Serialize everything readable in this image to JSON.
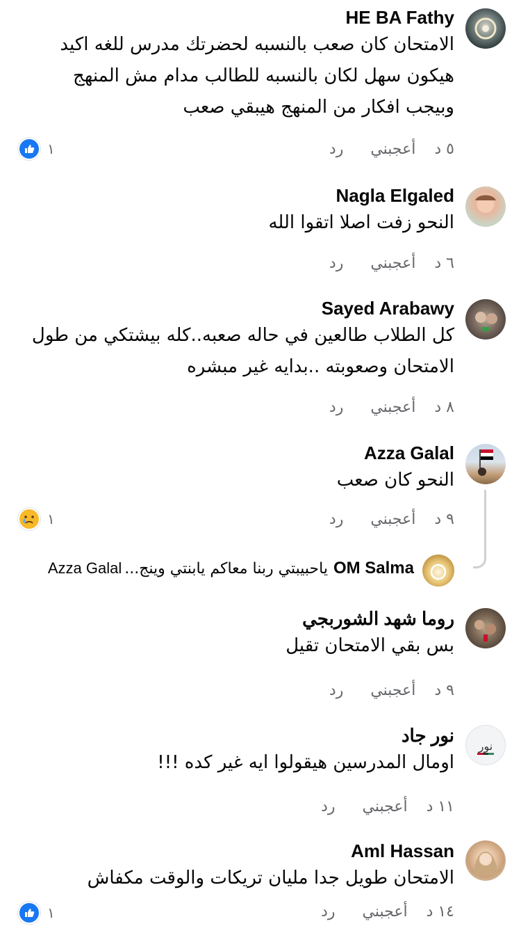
{
  "colors": {
    "meta": "#65676b",
    "like_blue": "#1877f2",
    "cry_yellow": "#f7b928",
    "thread": "#ced0d4"
  },
  "actions": {
    "like": "أعجبني",
    "reply": "رد"
  },
  "comments": [
    {
      "name": "HE BA Fathy",
      "text": "الامتحان كان صعب بالنسبه لحضرتك مدرس للغه اكيد هيكون سهل لكان بالنسبه للطالب مدام مش المنهج وبيجب افكار من المنهج هيبقي صعب",
      "time": "٥ د",
      "reaction": {
        "type": "like-icon",
        "count": "١"
      }
    },
    {
      "name": "Nagla Elgaled",
      "text": "النحو  زفت اصلا اتقوا الله",
      "time": "٦ د"
    },
    {
      "name": "Sayed Arabawy",
      "text": "كل الطلاب طالعين في حاله صعبه..كله بيشتكي من طول الامتحان وصعوبته ..بدايه غير مبشره",
      "time": "٨ د"
    },
    {
      "name": "Azza Galal",
      "text": "النحو كان صعب",
      "time": "٩ د",
      "reaction": {
        "type": "cry-icon",
        "count": "١"
      },
      "reply": {
        "name": "OM Salma",
        "text": "ياحبيبتي ربنا معاكم يابنتي وينج...",
        "mention": "Azza Galal"
      }
    },
    {
      "name": "روما شهد الشوربجي",
      "text": "بس بقي الامتحان تقيل",
      "time": "٩ د"
    },
    {
      "name": "نور جاد",
      "text": "اومال المدرسين هيقولوا ايه غير كده !!!",
      "time": "١١ د"
    },
    {
      "name": "Aml Hassan",
      "text": "الامتحان طويل جدا مليان تريكات والوقت مكفاش",
      "time": "١٤ د",
      "reaction": {
        "type": "like-icon",
        "count": "١"
      }
    }
  ]
}
